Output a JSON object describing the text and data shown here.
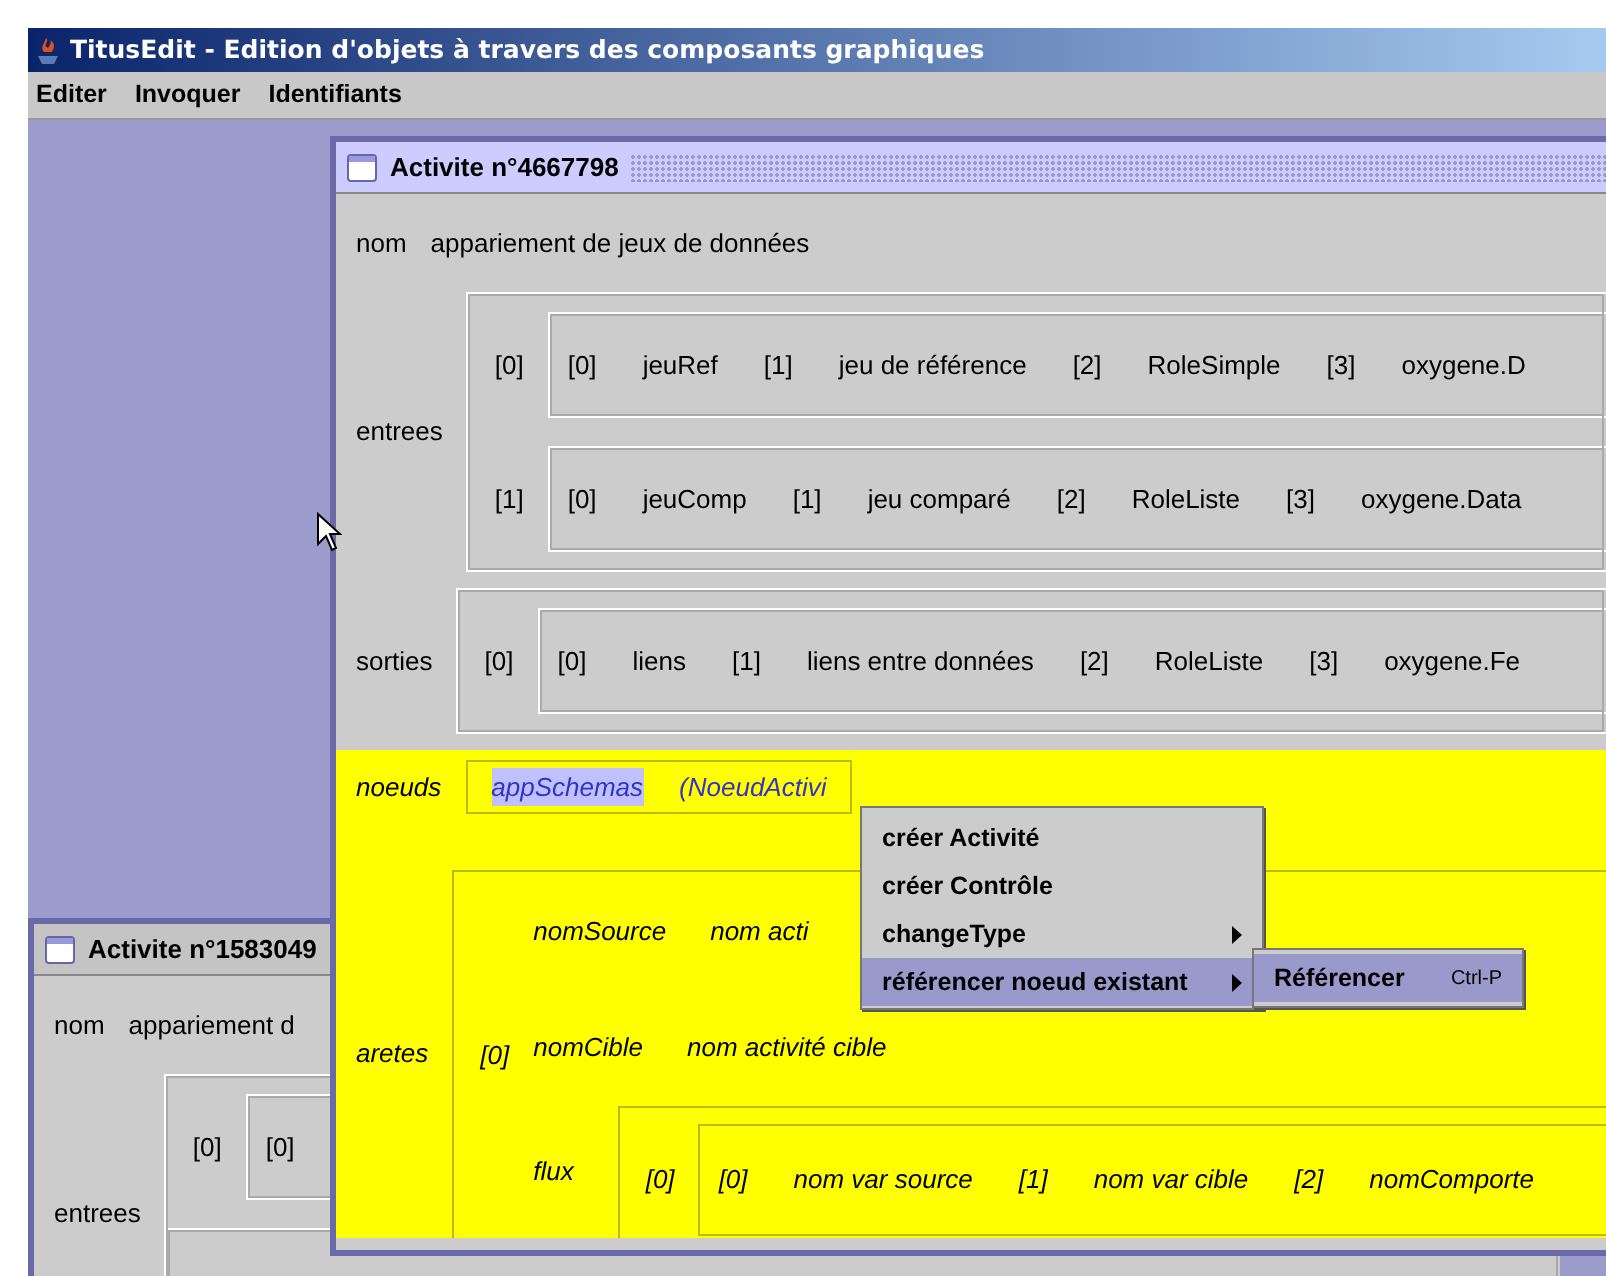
{
  "app": {
    "title": "TitusEdit - Edition d'objets à travers des composants graphiques"
  },
  "menu": [
    {
      "label": "Editer"
    },
    {
      "label": "Invoquer"
    },
    {
      "label": "Identifiants"
    }
  ],
  "back_window": {
    "title": "Activite n°1583049",
    "active": false,
    "fields": [
      {
        "kind": "text",
        "label": "nom",
        "value": "appariement d",
        "highlighted": false
      },
      {
        "kind": "list",
        "label": "entrees",
        "highlighted": false,
        "rows": [
          {
            "index": "[0]",
            "cells": [
              "[0]"
            ]
          },
          {
            "cells": []
          }
        ]
      }
    ]
  },
  "front_window": {
    "title": "Activite n°4667798",
    "active": true,
    "fields": [
      {
        "kind": "text",
        "label": "nom",
        "value": "appariement de jeux de données",
        "highlighted": false
      },
      {
        "kind": "list",
        "label": "entrees",
        "highlighted": false,
        "rows": [
          {
            "index": "[0]",
            "cells": [
              "[0]",
              "jeuRef",
              "[1]",
              "jeu de référence",
              "[2]",
              "RoleSimple",
              "[3]",
              "oxygene.D"
            ]
          },
          {
            "index": "[1]",
            "cells": [
              "[0]",
              "jeuComp",
              "[1]",
              "jeu comparé",
              "[2]",
              "RoleListe",
              "[3]",
              "oxygene.Data"
            ]
          }
        ]
      },
      {
        "kind": "list",
        "label": "sorties",
        "highlighted": false,
        "rows": [
          {
            "index": "[0]",
            "cells": [
              "[0]",
              "liens",
              "[1]",
              "liens entre données",
              "[2]",
              "RoleListe",
              "[3]",
              "oxygene.Fe"
            ]
          }
        ]
      },
      {
        "kind": "node",
        "label": "noeuds",
        "highlighted": true,
        "name": "appSchemas",
        "name_selected": true,
        "type": "(NoeudActivi"
      },
      {
        "kind": "edges",
        "label": "aretes",
        "highlighted": true,
        "index": "[0]",
        "attributes": [
          {
            "kind": "text",
            "label": "nomSource",
            "value": "nom acti"
          },
          {
            "kind": "text",
            "label": "nomCible",
            "value": "nom activité cible"
          },
          {
            "kind": "list",
            "label": "flux",
            "rows": [
              {
                "index": "[0]",
                "cells": [
                  "[0]",
                  "nom var source",
                  "[1]",
                  "nom var cible",
                  "[2]",
                  "nomComporte"
                ]
              }
            ]
          }
        ]
      }
    ]
  },
  "context_menu": {
    "items": [
      {
        "label": "créer Activité",
        "submenu": false,
        "selected": false
      },
      {
        "label": "créer Contrôle",
        "submenu": false,
        "selected": false
      },
      {
        "label": "changeType",
        "submenu": true,
        "selected": false
      },
      {
        "label": "référencer noeud existant",
        "submenu": true,
        "selected": true
      }
    ],
    "submenu": [
      {
        "label": "Référencer",
        "shortcut": "Ctrl-P",
        "selected": true
      }
    ]
  }
}
